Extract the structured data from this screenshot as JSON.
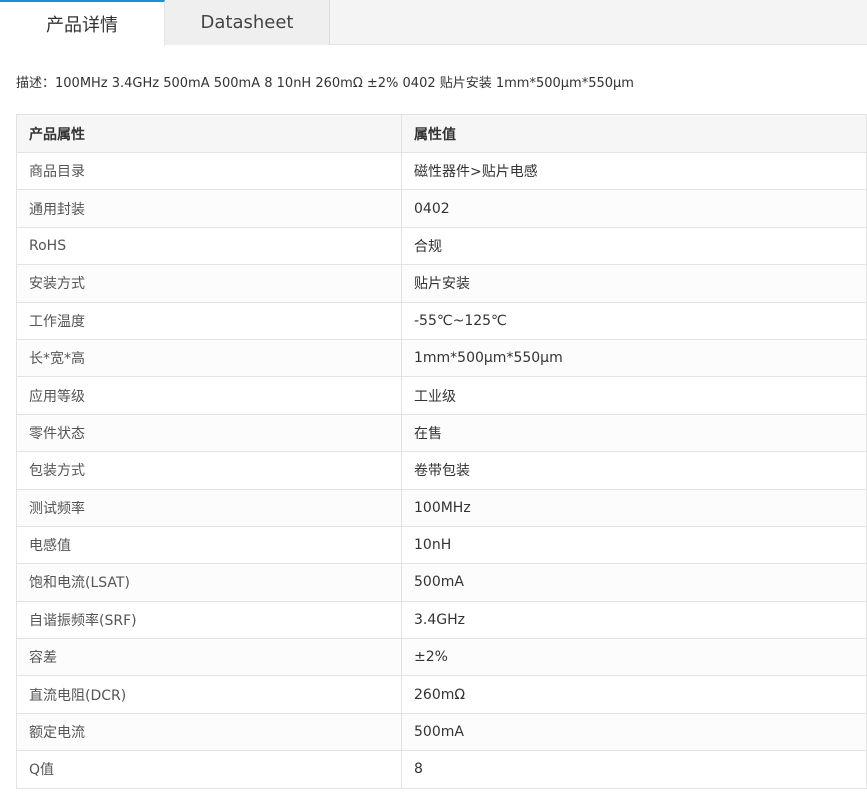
{
  "tabs": [
    {
      "label": "产品详情",
      "active": true
    },
    {
      "label": "Datasheet",
      "active": false
    }
  ],
  "description": "描述：100MHz 3.4GHz 500mA 500mA 8 10nH 260mΩ ±2% 0402 贴片安装 1mm*500μm*550μm",
  "table": {
    "headers": [
      "产品属性",
      "属性值"
    ],
    "rows": [
      [
        "商品目录",
        "磁性器件>贴片电感"
      ],
      [
        "通用封装",
        "0402"
      ],
      [
        "RoHS",
        "合规"
      ],
      [
        "安装方式",
        "贴片安装"
      ],
      [
        "工作温度",
        "-55℃~125℃"
      ],
      [
        "长*宽*高",
        "1mm*500μm*550μm"
      ],
      [
        "应用等级",
        "工业级"
      ],
      [
        "零件状态",
        "在售"
      ],
      [
        "包装方式",
        "卷带包装"
      ],
      [
        "测试频率",
        "100MHz"
      ],
      [
        "电感值",
        "10nH"
      ],
      [
        "饱和电流(LSAT)",
        "500mA"
      ],
      [
        "自谐振频率(SRF)",
        "3.4GHz"
      ],
      [
        "容差",
        "±2%"
      ],
      [
        "直流电阻(DCR)",
        "260mΩ"
      ],
      [
        "额定电流",
        "500mA"
      ],
      [
        "Q值",
        "8"
      ]
    ]
  },
  "colors": {
    "accent": "#1a8fd8"
  }
}
